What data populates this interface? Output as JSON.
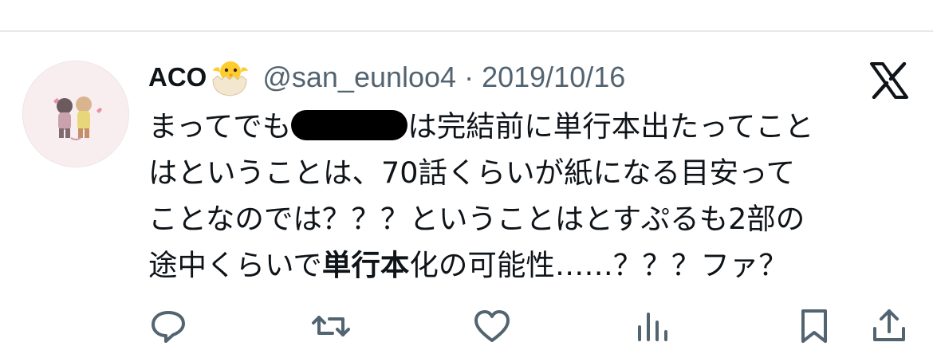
{
  "tweet": {
    "author": {
      "display_name": "ACO",
      "emoji_icon": "hatching-chick-icon",
      "handle": "@san_eunloo4",
      "separator": "·",
      "date": "2019/10/16"
    },
    "text_lines": {
      "line1_before": "まってでも",
      "line1_after": "は完結前に単行本出たってこと",
      "line2": "はということは、70話くらいが紙になる目安って",
      "line3": "ことなのでは？？？ということはとすぷるも2部の",
      "line4_before": "途中くらいで",
      "line4_bold": "単行本",
      "line4_after": "化の可能性……？？？ファ？"
    },
    "redacted": true
  },
  "actions": [
    "reply-icon",
    "retweet-icon",
    "like-icon",
    "views-icon",
    "bookmark-icon",
    "share-icon"
  ],
  "colors": {
    "text": "#0f1419",
    "secondary": "#536471",
    "divider": "#e7e9ea",
    "redaction": "#000000"
  }
}
